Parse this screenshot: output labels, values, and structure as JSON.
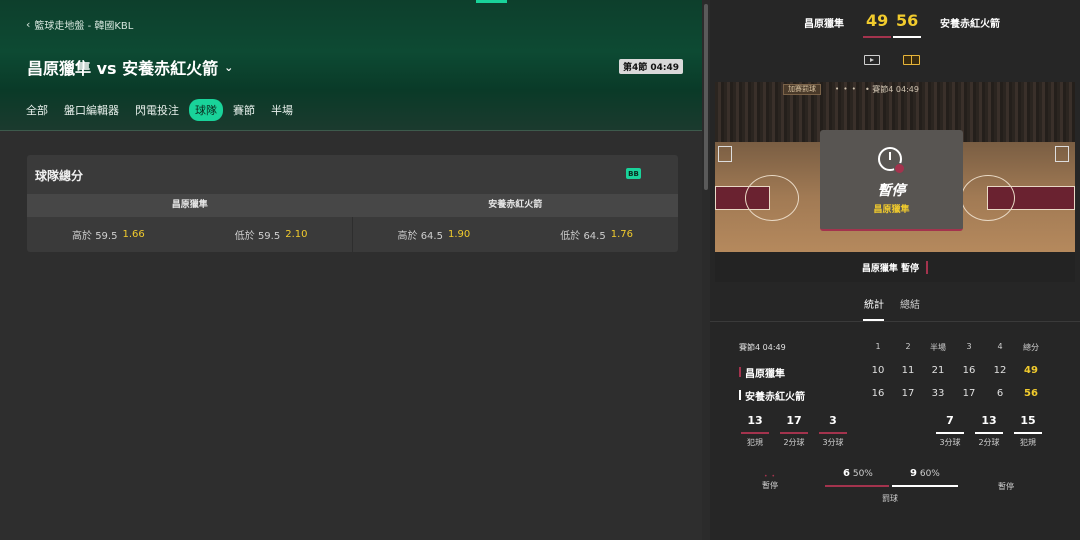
{
  "breadcrumb": {
    "text": "籃球走地盤 - 韓國KBL"
  },
  "match": {
    "title": "昌原獵隼 vs 安養赤紅火箭",
    "clock": "第4節 04:49"
  },
  "tabs": [
    "全部",
    "盤口編輯器",
    "閃電投注",
    "球隊",
    "賽節",
    "半場"
  ],
  "active_tab": "球隊",
  "market": {
    "title": "球隊總分",
    "badge": "BB",
    "team_a": "昌原獵隼",
    "team_b": "安養赤紅火箭",
    "odds": [
      {
        "label": "高於 59.5",
        "price": "1.66"
      },
      {
        "label": "低於 59.5",
        "price": "2.10"
      },
      {
        "label": "高於 64.5",
        "price": "1.90"
      },
      {
        "label": "低於 64.5",
        "price": "1.76"
      }
    ]
  },
  "scoreboard": {
    "team_a": "昌原獵隼",
    "team_b": "安養赤紅火箭",
    "score_a": "49",
    "score_b": "56",
    "color_a": "#a3334d",
    "color_b": "#ffffff"
  },
  "court": {
    "label": "加賽罰球",
    "dots": "• • •",
    "time": "• 賽節4 04:49",
    "pause_title": "暫停",
    "pause_team": "昌原獵隼",
    "status_text": "昌原獵隼 暫停"
  },
  "sub_tabs": {
    "stats": "統計",
    "summary": "總結"
  },
  "box": {
    "period_label": "賽節4",
    "period_time": "04:49",
    "headers": [
      "1",
      "2",
      "半場",
      "3",
      "4",
      "總分"
    ],
    "rows": [
      {
        "team": "昌原獵隼",
        "values": [
          "10",
          "11",
          "21",
          "16",
          "12",
          "49"
        ]
      },
      {
        "team": "安養赤紅火箭",
        "values": [
          "16",
          "17",
          "33",
          "17",
          "6",
          "56"
        ]
      }
    ]
  },
  "team_stats": {
    "a": [
      {
        "value": "13",
        "label": "犯規"
      },
      {
        "value": "17",
        "label": "2分球"
      },
      {
        "value": "3",
        "label": "3分球"
      }
    ],
    "b": [
      {
        "value": "7",
        "label": "3分球"
      },
      {
        "value": "13",
        "label": "2分球"
      },
      {
        "value": "15",
        "label": "犯規"
      }
    ]
  },
  "timeouts": {
    "label": "暫停",
    "dots_a": "• •"
  },
  "free_throws": {
    "label": "罰球",
    "a_made": "6",
    "a_pct": "50%",
    "b_made": "9",
    "b_pct": "60%"
  }
}
